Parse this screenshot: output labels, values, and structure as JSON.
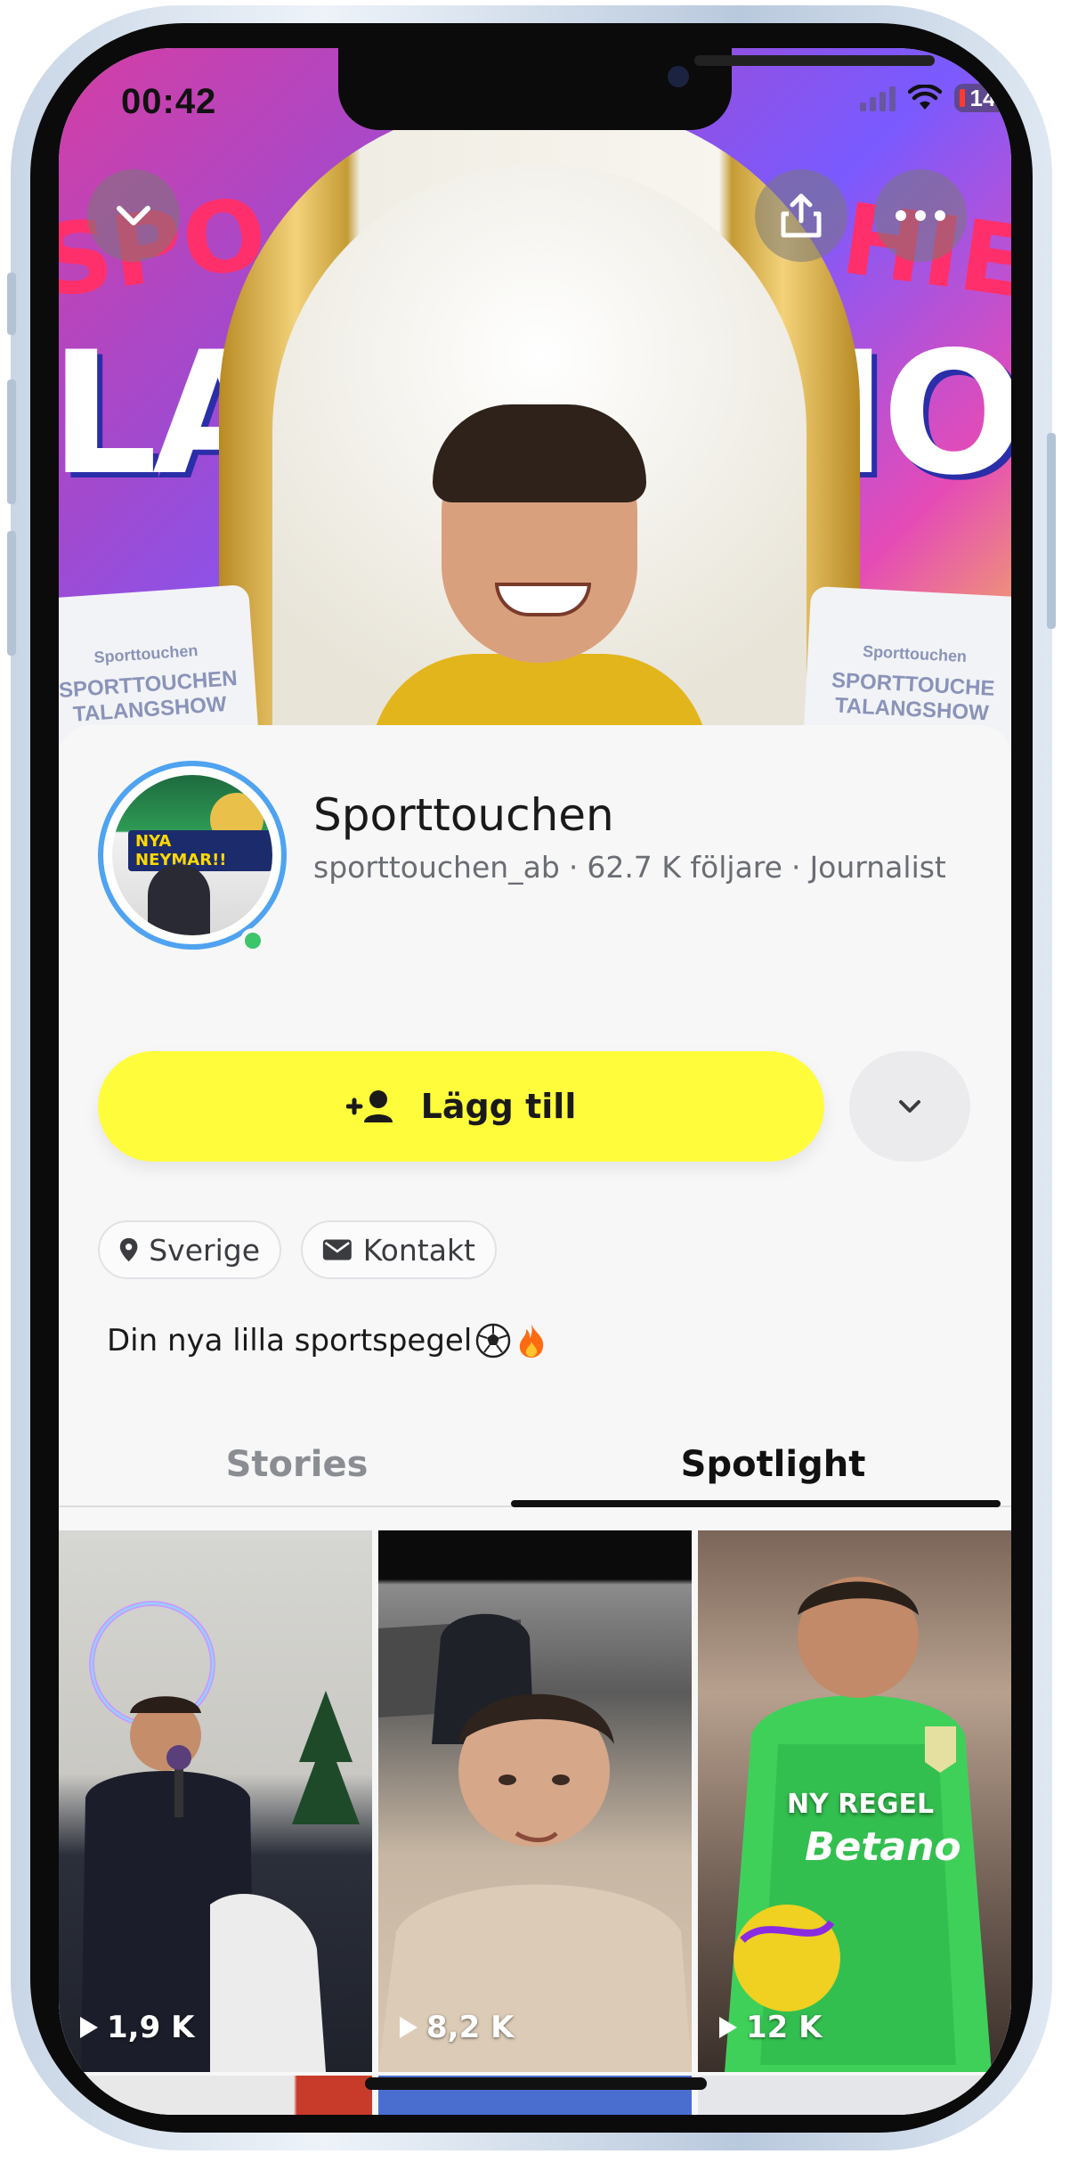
{
  "status_bar": {
    "time": "00:42",
    "battery": "14"
  },
  "banner": {
    "left_pink": "SPO",
    "left_big": "LA",
    "right_pink": "HIEN",
    "right_big": "IO",
    "sign_left_logo": "Sporttouchen",
    "sign_left_text": "SPORTTOUCHEN TALANGSHOW",
    "sign_right_logo": "Sporttouchen",
    "sign_right_text": "SPORTTOUCHE TALANGSHOW"
  },
  "profile": {
    "avatar_caption": "NYA NEYMAR!!",
    "name": "Sporttouchen",
    "username": "sporttouchen_ab",
    "followers": "62.7 K följare",
    "category": "Journalist",
    "separator": "·",
    "add_label": "Lägg till",
    "chips": [
      {
        "label": "Sverige",
        "icon": "location-pin-icon"
      },
      {
        "label": "Kontakt",
        "icon": "mail-icon"
      }
    ],
    "bio": "Din nya lilla sportspegel"
  },
  "tabs": [
    {
      "label": "Stories",
      "active": false
    },
    {
      "label": "Spotlight",
      "active": true
    }
  ],
  "spotlight": [
    {
      "views": "1,9 K"
    },
    {
      "views": "8,2 K"
    },
    {
      "views": "12 K",
      "overlay_text": "NY REGEL",
      "sponsor": "Betano"
    }
  ],
  "colors": {
    "accent_yellow": "#fffc3c",
    "ring_blue": "#4fa3f0",
    "online_green": "#3cc56a"
  }
}
